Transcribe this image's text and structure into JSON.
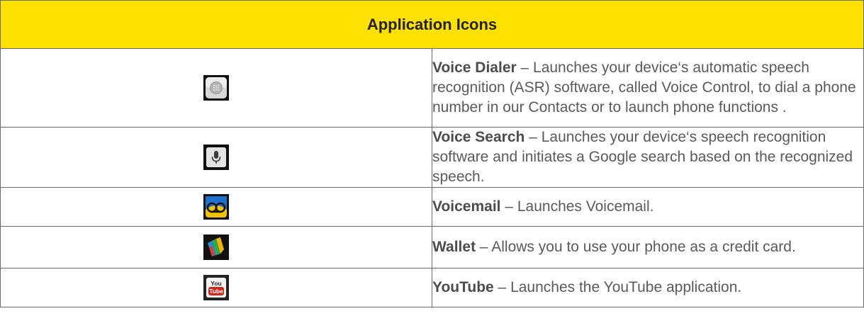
{
  "header": {
    "title": "Application Icons"
  },
  "rows": [
    {
      "icon": "voice-dialer-icon",
      "name": "Voice Dialer",
      "description": " – Launches your device‘s automatic speech recognition (ASR) software, called Voice Control, to dial a phone number in our Contacts or to launch phone functions ."
    },
    {
      "icon": "voice-search-icon",
      "name": "Voice Search",
      "description": " – Launches your device‘s speech recognition software and initiates a Google search based on the recognized speech."
    },
    {
      "icon": "voicemail-icon",
      "name": "Voicemail",
      "description": " – Launches Voicemail."
    },
    {
      "icon": "wallet-icon",
      "name": "Wallet",
      "description": " – Allows you to use your phone as a credit card."
    },
    {
      "icon": "youtube-icon",
      "name": "YouTube",
      "description": " – Launches the YouTube application.",
      "icon_text_top": "You",
      "icon_text_bottom": "Tube"
    }
  ],
  "colors": {
    "header_background": "#ffe100",
    "border": "#6b6b6b",
    "text": "#5a5a5a"
  }
}
